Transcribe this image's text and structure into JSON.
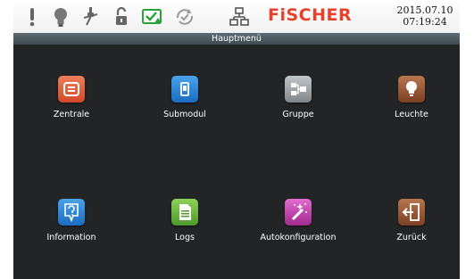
{
  "header": {
    "brand": "FiSCHER",
    "date": "2015.07.10",
    "time": "07:19:24",
    "status_icons": [
      "alert-icon",
      "bulb-icon",
      "plug-icon",
      "unlock-icon",
      "battery-check-icon",
      "sync-icon",
      "network-icon"
    ]
  },
  "title": "Hauptmenü",
  "menu": [
    {
      "label": "Zentrale",
      "icon": "central-unit-icon",
      "color": "#e0603e"
    },
    {
      "label": "Submodul",
      "icon": "submodule-icon",
      "color": "#2a86d6"
    },
    {
      "label": "Gruppe",
      "icon": "group-icon",
      "color": "#9aa0a4"
    },
    {
      "label": "Leuchte",
      "icon": "luminaire-icon",
      "color": "#9a5a38"
    },
    {
      "label": "Information",
      "icon": "information-icon",
      "color": "#2a86d6"
    },
    {
      "label": "Logs",
      "icon": "logs-icon",
      "color": "#6db33f"
    },
    {
      "label": "Autokonfiguration",
      "icon": "magic-wand-icon",
      "color": "#c23aa8"
    },
    {
      "label": "Zurück",
      "icon": "exit-door-icon",
      "color": "#9a5a38"
    }
  ]
}
